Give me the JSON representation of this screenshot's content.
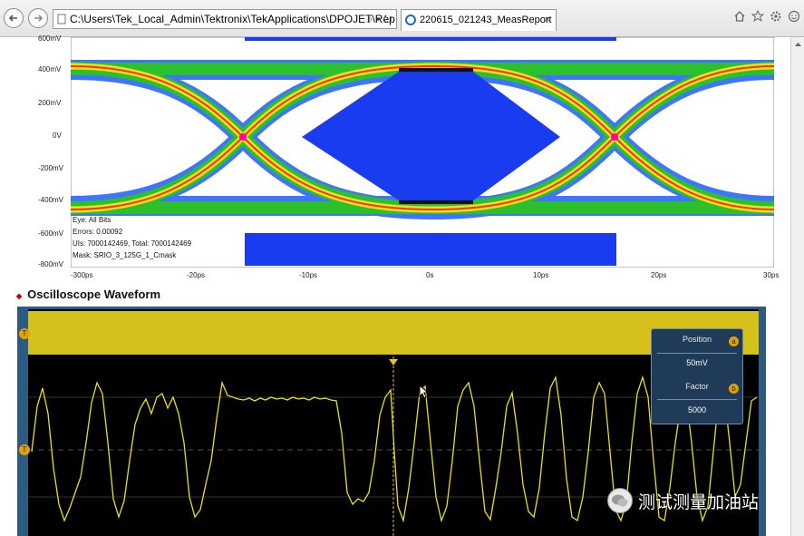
{
  "browser": {
    "address": "C:\\Users\\Tek_Local_Admin\\Tektronix\\TekApplications\\DPOJET\\Rep",
    "address_tools": "⌕ ▾ ↻",
    "tab_title": "220615_021243_MeasReport",
    "tab_close": "×"
  },
  "eye": {
    "y_ticks": [
      "600mV",
      "400mV",
      "200mV",
      "0V",
      "-200mV",
      "-400mV",
      "-600mV",
      "-800mV"
    ],
    "x_ticks": [
      "-300ps",
      "-20ps",
      "-10ps",
      "0s",
      "10ps",
      "20ps",
      "30ps"
    ],
    "info_lines": [
      "Eye: All Bits",
      "Errors: 0.00092",
      "UIs: 7000142469, Total: 7000142469",
      "Mask: SRIO_3_125G_1_Cmask"
    ],
    "colors": {
      "mask": "#1a3cf0",
      "trace_outer": "#1e5cff",
      "trace_mid": "#2cc02c",
      "trace_core": "#f0e020",
      "trace_hot": "#ff3010"
    }
  },
  "section": {
    "title": "Oscilloscope Waveform"
  },
  "scope": {
    "panel": {
      "label1": "Position",
      "value1": "50mV",
      "label2": "Factor",
      "value2": "5000"
    },
    "markers": {
      "left_top": "T",
      "left_mid": "T",
      "badge1": "a",
      "badge2": "b"
    },
    "colors": {
      "trace": "#e8e020",
      "background": "#000000",
      "frame": "#2b5b83"
    }
  },
  "watermark": {
    "text": "测试测量加油站"
  }
}
